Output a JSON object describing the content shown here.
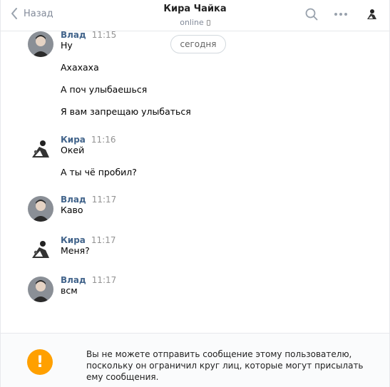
{
  "header": {
    "back_label": "Назад",
    "title": "Кира Чайка",
    "status": "online",
    "icons": [
      "chevron-left-icon",
      "search-icon",
      "more-icon",
      "avatar"
    ]
  },
  "date_divider": "сегодня",
  "messages": [
    {
      "author": "Влад",
      "time": "11:15",
      "avatar": "vlad",
      "lines": [
        "Ну",
        "Ахахаха",
        "А поч улыбаешься",
        "Я вам запрещаю улыбаться"
      ]
    },
    {
      "author": "Кира",
      "time": "11:16",
      "avatar": "kira",
      "lines": [
        "Окей",
        "А ты чё пробил?"
      ]
    },
    {
      "author": "Влад",
      "time": "11:17",
      "avatar": "vlad",
      "lines": [
        "Каво"
      ]
    },
    {
      "author": "Кира",
      "time": "11:17",
      "avatar": "kira",
      "lines": [
        "Меня?"
      ]
    },
    {
      "author": "Влад",
      "time": "11:17",
      "avatar": "vlad",
      "lines": [
        "всм"
      ]
    }
  ],
  "notice": {
    "icon": "warning-icon",
    "glyph": "!",
    "text": "Вы не можете отправить сообщение этому пользователю, поскольку он ограничил круг лиц, которые могут присылать ему сообщения."
  },
  "colors": {
    "author": "#42648b",
    "muted": "#828a99",
    "warning": "#ffa000",
    "border": "#e7e8ec"
  }
}
